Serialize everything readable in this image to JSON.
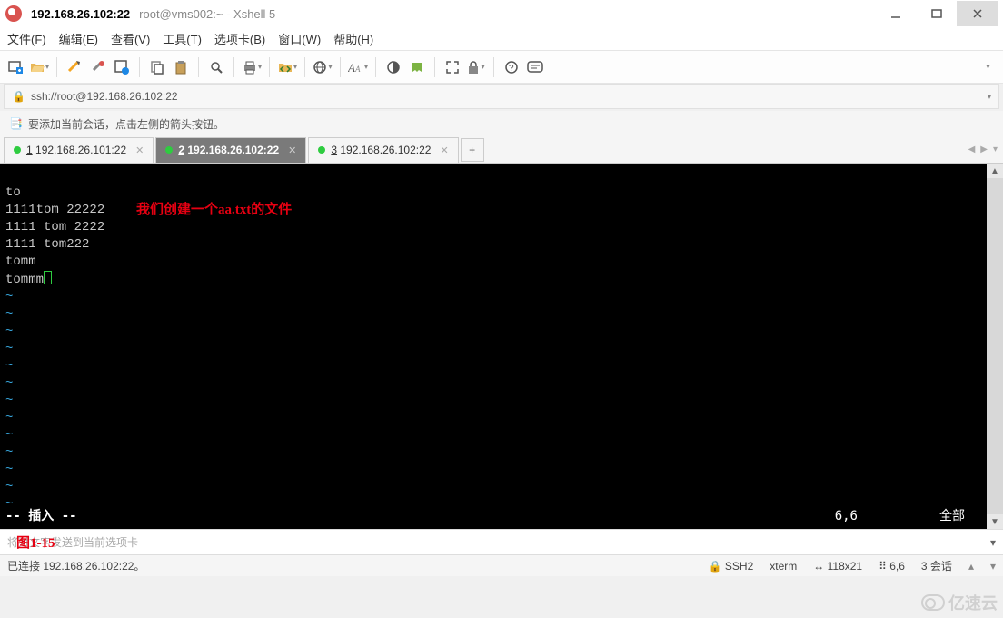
{
  "title": {
    "host": "192.168.26.102:22",
    "rest": "root@vms002:~ - Xshell 5"
  },
  "menu": {
    "file": "文件(F)",
    "edit": "编辑(E)",
    "view": "查看(V)",
    "tools": "工具(T)",
    "tab": "选项卡(B)",
    "window": "窗口(W)",
    "help": "帮助(H)"
  },
  "address": {
    "url": "ssh://root@192.168.26.102:22"
  },
  "hint": {
    "text": "要添加当前会话，点击左侧的箭头按钮。"
  },
  "tabs": {
    "t1": {
      "num": "1",
      "label": " 192.168.26.101:22"
    },
    "t2": {
      "num": "2",
      "label": " 192.168.26.102:22"
    },
    "t3": {
      "num": "3",
      "label": " 192.168.26.102:22"
    }
  },
  "term": {
    "l1": "to",
    "l2": "1111tom 22222",
    "l3": "1111 tom 2222",
    "l4": "1111 tom222",
    "l5": "tomm",
    "l6": "tommm",
    "annot": "我们创建一个aa.txt的文件",
    "mode": "-- 插入 --",
    "pos": "6,6",
    "all": "全部"
  },
  "compose": {
    "placeholder": "将对文字发送到当前选项卡",
    "fig": "图1-15"
  },
  "status": {
    "conn": "已连接 192.168.26.102:22。",
    "proto": "SSH2",
    "term": "xterm",
    "size": "118x21",
    "rc": "6,6",
    "sess": "3 会话"
  },
  "watermark": "亿速云"
}
